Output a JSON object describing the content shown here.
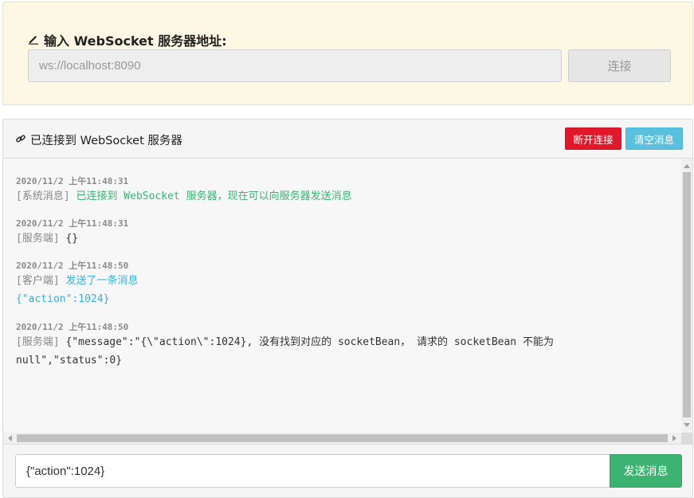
{
  "connect": {
    "label": "输入 WebSocket 服务器地址:",
    "url_value": "ws://localhost:8090",
    "connect_label": "连接"
  },
  "header": {
    "status": "已连接到 WebSocket 服务器",
    "disconnect_label": "断开连接",
    "clear_label": "清空消息"
  },
  "messages": [
    {
      "time": "2020/11/2 上午11:48:31",
      "tag": "[系统消息]",
      "text": "已连接到 WebSocket 服务器，现在可以向服务器发送消息",
      "color": "#3cb371"
    },
    {
      "time": "2020/11/2 上午11:48:31",
      "tag": "[服务端]",
      "text": "{}",
      "color": "#333333"
    },
    {
      "time": "2020/11/2 上午11:48:50",
      "tag": "[客户端]",
      "text": "发送了一条消息",
      "extra": "{\"action\":1024}",
      "color": "#3eb0dc"
    },
    {
      "time": "2020/11/2 上午11:48:50",
      "tag": "[服务端]",
      "text": "{\"message\":\"{\\\"action\\\":1024}, 没有找到对应的 socketBean， 请求的 socketBean 不能为",
      "extra": "null\",\"status\":0}",
      "color": "#333333"
    }
  ],
  "footer": {
    "input_value": "{\"action\":1024}",
    "send_label": "发送消息"
  },
  "colors": {
    "connect_panel_bg": "#fcf8e3",
    "danger": "#e0182a",
    "info": "#5bc0de",
    "success": "#3cb371"
  }
}
